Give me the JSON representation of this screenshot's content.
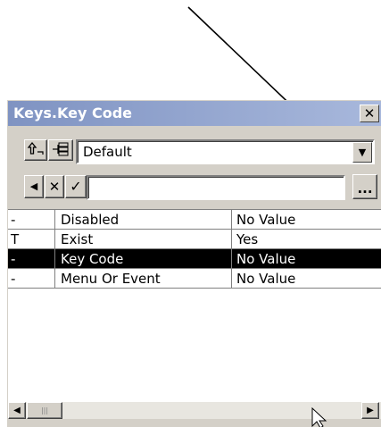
{
  "window": {
    "title": "Keys.Key Code",
    "close_glyph": "✕"
  },
  "toolbar": {
    "combo_value": "Default",
    "text_value": "",
    "ellipsis_label": "...",
    "cancel_glyph": "✕",
    "accept_glyph": "✓"
  },
  "rows": [
    {
      "flag": "-",
      "name": "Disabled",
      "value": "No Value",
      "selected": false
    },
    {
      "flag": "T",
      "name": "Exist",
      "value": "Yes",
      "selected": false
    },
    {
      "flag": "-",
      "name": "Key Code",
      "value": "No Value",
      "selected": true
    },
    {
      "flag": "-",
      "name": "Menu Or Event",
      "value": "No Value",
      "selected": false
    }
  ],
  "icons": [
    "up-level-icon",
    "hierarchy-icon",
    "left-arrow-icon",
    "close-icon",
    "checkmark-icon",
    "chevron-down-icon",
    "scroll-left-icon",
    "scroll-right-icon",
    "mouse-cursor-icon",
    "callout-arrow"
  ]
}
